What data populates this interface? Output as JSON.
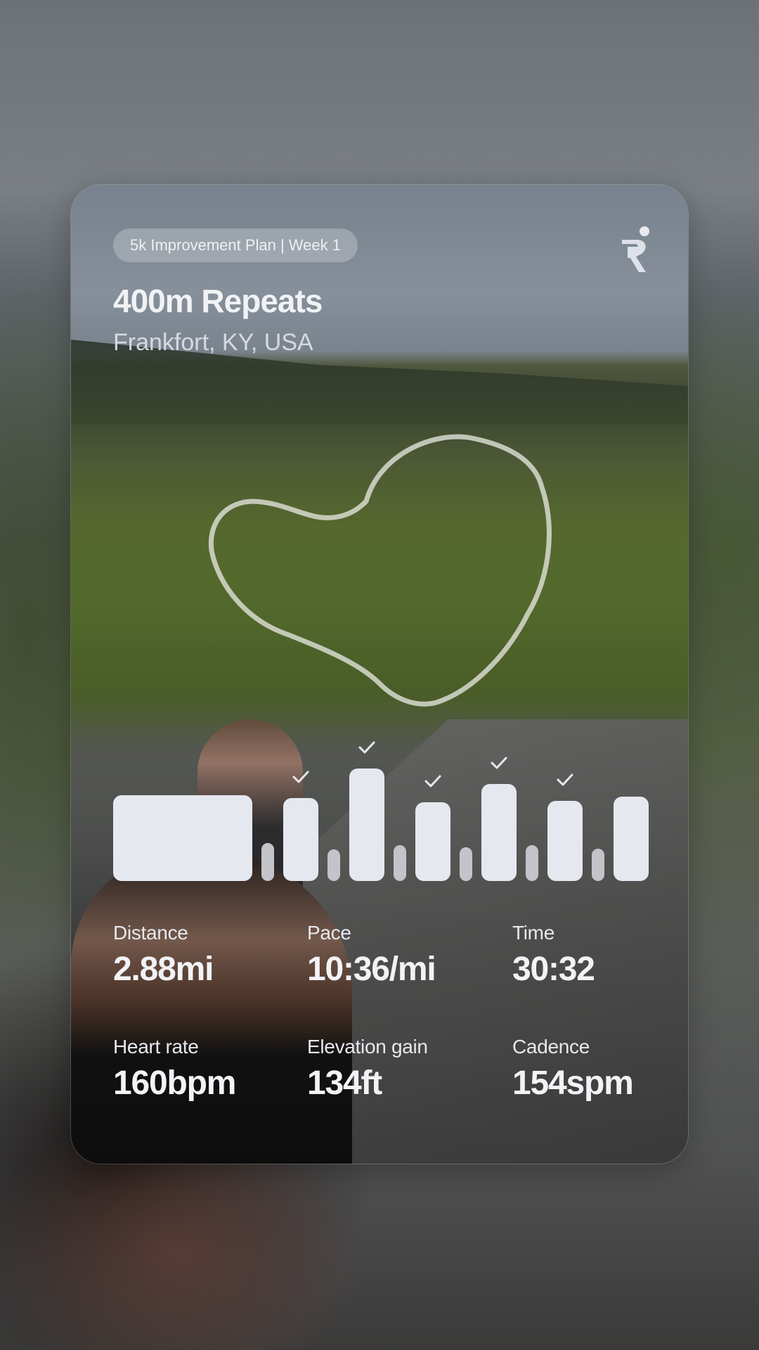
{
  "plan_badge": "5k Improvement Plan | Week 1",
  "workout": {
    "title": "400m Repeats",
    "location": "Frankfort, KY, USA"
  },
  "intervals": {
    "type": "bar",
    "segments": [
      {
        "kind": "warmup",
        "level": 0.76,
        "completed": false
      },
      {
        "kind": "recovery",
        "level": 0.34,
        "completed": false
      },
      {
        "kind": "repeat",
        "level": 0.74,
        "completed": true
      },
      {
        "kind": "recovery",
        "level": 0.28,
        "completed": false
      },
      {
        "kind": "repeat",
        "level": 1.0,
        "completed": true
      },
      {
        "kind": "recovery",
        "level": 0.32,
        "completed": false
      },
      {
        "kind": "repeat",
        "level": 0.7,
        "completed": true
      },
      {
        "kind": "recovery",
        "level": 0.3,
        "completed": false
      },
      {
        "kind": "repeat",
        "level": 0.86,
        "completed": true
      },
      {
        "kind": "recovery",
        "level": 0.32,
        "completed": false
      },
      {
        "kind": "repeat",
        "level": 0.71,
        "completed": true
      },
      {
        "kind": "recovery",
        "level": 0.29,
        "completed": false
      },
      {
        "kind": "repeat",
        "level": 0.75,
        "completed": false
      }
    ]
  },
  "stats": {
    "distance": {
      "label": "Distance",
      "value": "2.88mi"
    },
    "pace": {
      "label": "Pace",
      "value": "10:36/mi"
    },
    "time": {
      "label": "Time",
      "value": "30:32"
    },
    "heart_rate": {
      "label": "Heart rate",
      "value": "160bpm"
    },
    "elevation": {
      "label": "Elevation gain",
      "value": "134ft"
    },
    "cadence": {
      "label": "Cadence",
      "value": "154spm"
    }
  },
  "icons": {
    "logo": "runner-logo-icon",
    "check": "checkmark-icon"
  },
  "colors": {
    "bar": "#e6e8f0",
    "recovery_bar": "#c2c4c9",
    "text": "#f1f2f5"
  }
}
